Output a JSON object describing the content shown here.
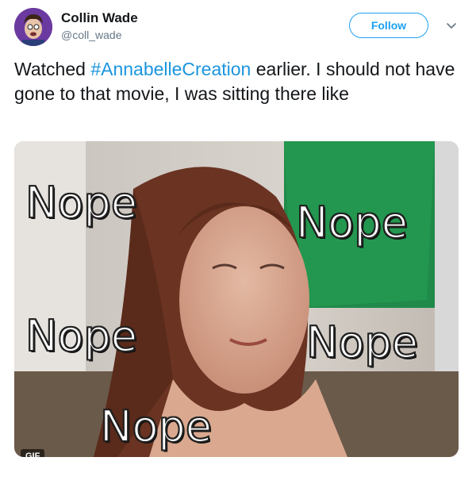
{
  "user": {
    "display_name": "Collin Wade",
    "handle": "@coll_wade",
    "avatar_icon": "avatar-photo"
  },
  "follow_label": "Follow",
  "menu_icon": "chevron-down-icon",
  "tweet": {
    "text_before": "Watched ",
    "hashtag": "#AnnabelleCreation",
    "text_after": " earlier. I should not have gone to that movie, I was sitting there like"
  },
  "media": {
    "captions": [
      "Nope",
      "Nope",
      "Nope",
      "Nope",
      "Nope"
    ],
    "badge": "GIF"
  },
  "colors": {
    "accent": "#1da1f2",
    "hashtag": "#1b95e0",
    "text": "#14171a",
    "secondary": "#657786"
  }
}
